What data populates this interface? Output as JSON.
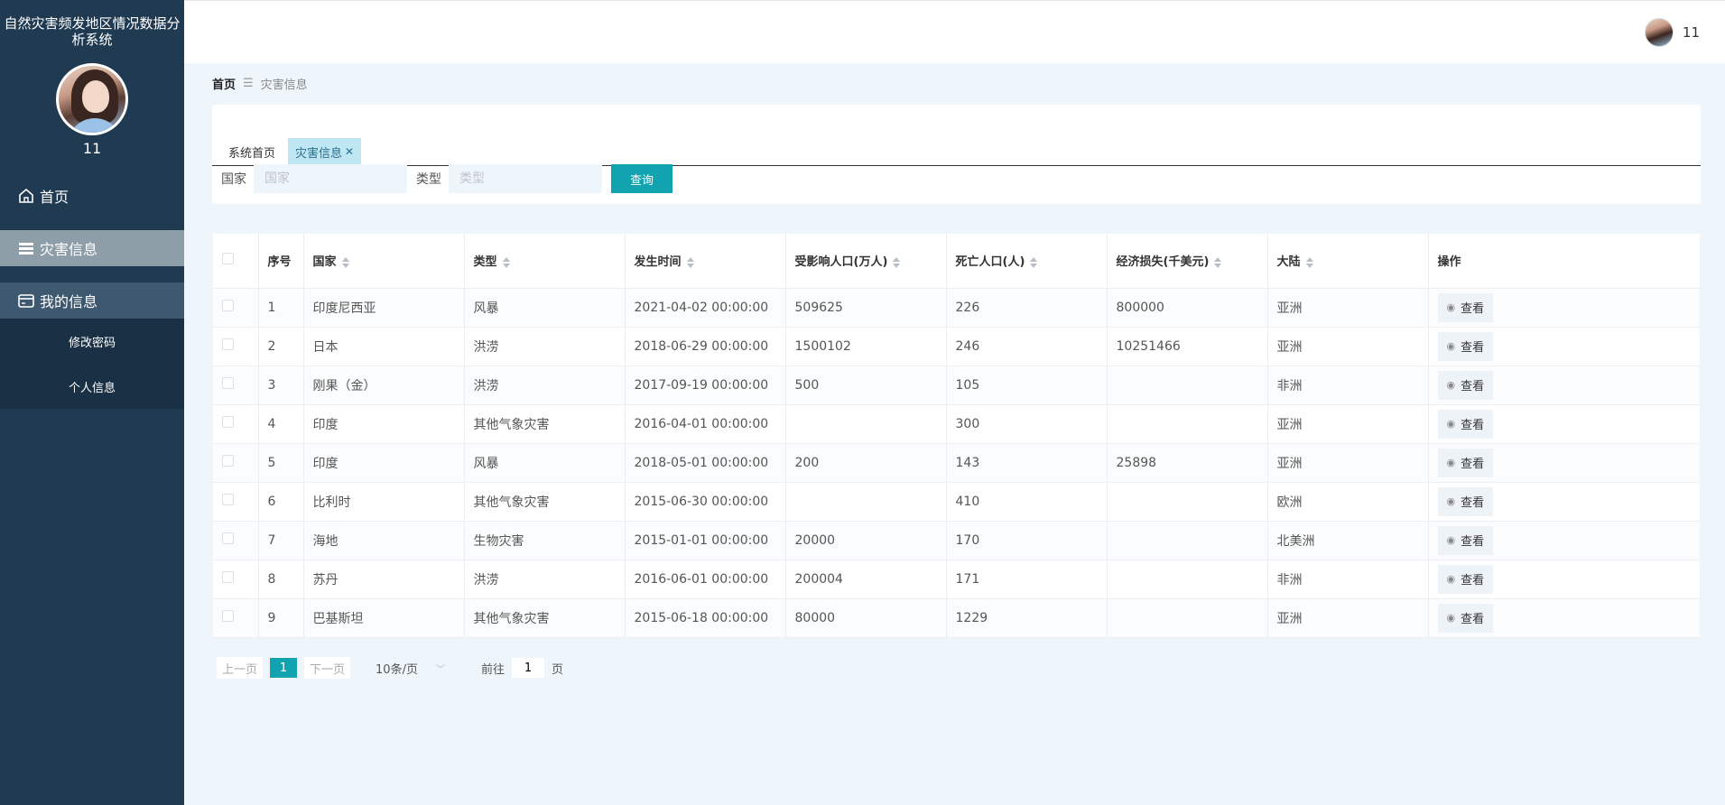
{
  "app": {
    "title": "自然灾害频发地区情况数据分析系统",
    "user_name": "11"
  },
  "sidebar": {
    "items": [
      {
        "label": "首页",
        "icon": "home-icon"
      },
      {
        "label": "灾害信息",
        "icon": "list-icon"
      },
      {
        "label": "我的信息",
        "icon": "card-icon"
      }
    ],
    "submenu": [
      {
        "label": "修改密码"
      },
      {
        "label": "个人信息"
      }
    ]
  },
  "breadcrumb": {
    "home": "首页",
    "separator": "☰",
    "current": "灾害信息"
  },
  "tabs": [
    {
      "label": "系统首页"
    },
    {
      "label": "灾害信息"
    }
  ],
  "search": {
    "country_label": "国家",
    "country_placeholder": "国家",
    "type_label": "类型",
    "type_placeholder": "类型",
    "query_button": "查询"
  },
  "table": {
    "headers": [
      "序号",
      "国家",
      "类型",
      "发生时间",
      "受影响人口(万人)",
      "死亡人口(人)",
      "经济损失(千美元)",
      "大陆",
      "操作"
    ],
    "view_label": "查看",
    "rows": [
      {
        "no": "1",
        "country": "印度尼西亚",
        "type": "风暴",
        "time": "2021-04-02 00:00:00",
        "affected": "509625",
        "deaths": "226",
        "loss": "800000",
        "continent": "亚洲"
      },
      {
        "no": "2",
        "country": "日本",
        "type": "洪涝",
        "time": "2018-06-29 00:00:00",
        "affected": "1500102",
        "deaths": "246",
        "loss": "10251466",
        "continent": "亚洲"
      },
      {
        "no": "3",
        "country": "刚果（金）",
        "type": "洪涝",
        "time": "2017-09-19 00:00:00",
        "affected": "500",
        "deaths": "105",
        "loss": "",
        "continent": "非洲"
      },
      {
        "no": "4",
        "country": "印度",
        "type": "其他气象灾害",
        "time": "2016-04-01 00:00:00",
        "affected": "",
        "deaths": "300",
        "loss": "",
        "continent": "亚洲"
      },
      {
        "no": "5",
        "country": "印度",
        "type": "风暴",
        "time": "2018-05-01 00:00:00",
        "affected": "200",
        "deaths": "143",
        "loss": "25898",
        "continent": "亚洲"
      },
      {
        "no": "6",
        "country": "比利时",
        "type": "其他气象灾害",
        "time": "2015-06-30 00:00:00",
        "affected": "",
        "deaths": "410",
        "loss": "",
        "continent": "欧洲"
      },
      {
        "no": "7",
        "country": "海地",
        "type": "生物灾害",
        "time": "2015-01-01 00:00:00",
        "affected": "20000",
        "deaths": "170",
        "loss": "",
        "continent": "北美洲"
      },
      {
        "no": "8",
        "country": "苏丹",
        "type": "洪涝",
        "time": "2016-06-01 00:00:00",
        "affected": "200004",
        "deaths": "171",
        "loss": "",
        "continent": "非洲"
      },
      {
        "no": "9",
        "country": "巴基斯坦",
        "type": "其他气象灾害",
        "time": "2015-06-18 00:00:00",
        "affected": "80000",
        "deaths": "1229",
        "loss": "",
        "continent": "亚洲"
      }
    ]
  },
  "pagination": {
    "prev": "上一页",
    "current_page": "1",
    "next": "下一页",
    "page_size": "10条/页",
    "goto_prefix": "前往",
    "goto_value": "1",
    "goto_suffix": "页"
  },
  "colors": {
    "sidebar_bg": "#203a52",
    "accent": "#12a3b0",
    "page_bg": "#eef5fb"
  }
}
